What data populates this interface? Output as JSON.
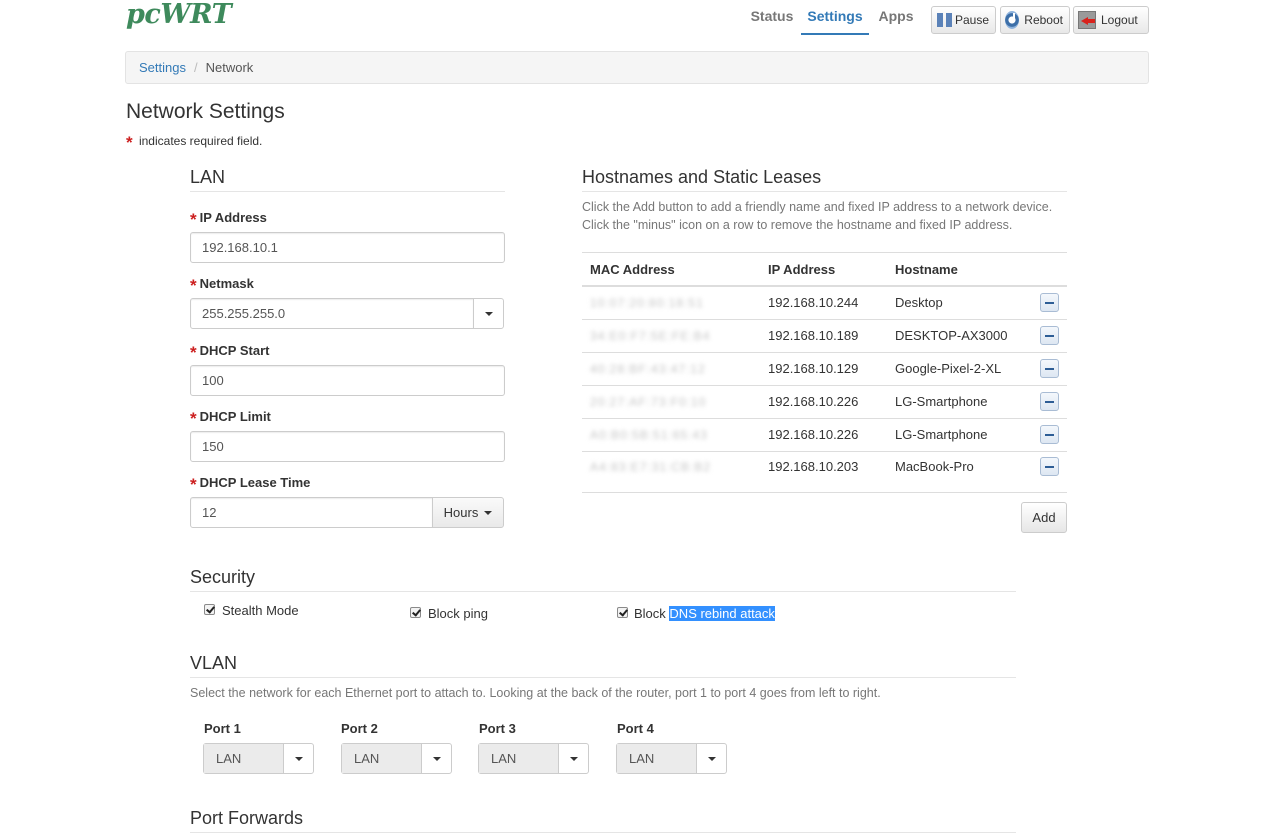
{
  "header": {
    "logo": "pcWRT",
    "tabs": [
      "Status",
      "Settings",
      "Apps"
    ],
    "active_tab": "Settings",
    "buttons": {
      "pause": "Pause",
      "reboot": "Reboot",
      "logout": "Logout"
    }
  },
  "breadcrumb": {
    "parent": "Settings",
    "separator": "/",
    "current": "Network"
  },
  "page": {
    "title": "Network Settings",
    "required_mark": "*",
    "required_note": "indicates required field."
  },
  "lan": {
    "heading": "LAN",
    "ip_label": "IP Address",
    "ip_value": "192.168.10.1",
    "netmask_label": "Netmask",
    "netmask_value": "255.255.255.0",
    "dhcp_start_label": "DHCP Start",
    "dhcp_start_value": "100",
    "dhcp_limit_label": "DHCP Limit",
    "dhcp_limit_value": "150",
    "lease_time_label": "DHCP Lease Time",
    "lease_time_value": "12",
    "lease_time_unit": "Hours"
  },
  "leases": {
    "heading": "Hostnames and Static Leases",
    "desc_line1": "Click the Add button to add a friendly name and fixed IP address to a network device.",
    "desc_line2": "Click the \"minus\" icon on a row to remove the hostname and fixed IP address.",
    "columns": [
      "MAC Address",
      "IP Address",
      "Hostname"
    ],
    "rows": [
      {
        "mac": "10:07:20:80:18:51",
        "ip": "192.168.10.244",
        "hostname": "Desktop"
      },
      {
        "mac": "34:E0:F7:5E:FE:B4",
        "ip": "192.168.10.189",
        "hostname": "DESKTOP-AX3000"
      },
      {
        "mac": "40:28:BF:43:47:12",
        "ip": "192.168.10.129",
        "hostname": "Google-Pixel-2-XL"
      },
      {
        "mac": "20:27:AF:73:F0:10",
        "ip": "192.168.10.226",
        "hostname": "LG-Smartphone"
      },
      {
        "mac": "A0:B0:5B:51:65:43",
        "ip": "192.168.10.226",
        "hostname": "LG-Smartphone"
      },
      {
        "mac": "A4:83:E7:31:CB:B2",
        "ip": "192.168.10.203",
        "hostname": "MacBook-Pro"
      }
    ],
    "add_label": "Add"
  },
  "security": {
    "heading": "Security",
    "stealth_label": "Stealth Mode",
    "ping_label": "Block ping",
    "dns_label_prefix": "Block",
    "dns_label_selected": "DNS rebind attack"
  },
  "vlan": {
    "heading": "VLAN",
    "description": "Select the network for each Ethernet port to attach to. Looking at the back of the router, port 1 to port 4 goes from left to right.",
    "ports": [
      {
        "label": "Port 1",
        "value": "LAN"
      },
      {
        "label": "Port 2",
        "value": "LAN"
      },
      {
        "label": "Port 3",
        "value": "LAN"
      },
      {
        "label": "Port 4",
        "value": "LAN"
      }
    ]
  },
  "port_forwards": {
    "heading": "Port Forwards"
  },
  "colors": {
    "link": "#337ab7",
    "required": "#cc1f1f",
    "selection": "#3390ff",
    "logo": "#3e8a5c"
  }
}
